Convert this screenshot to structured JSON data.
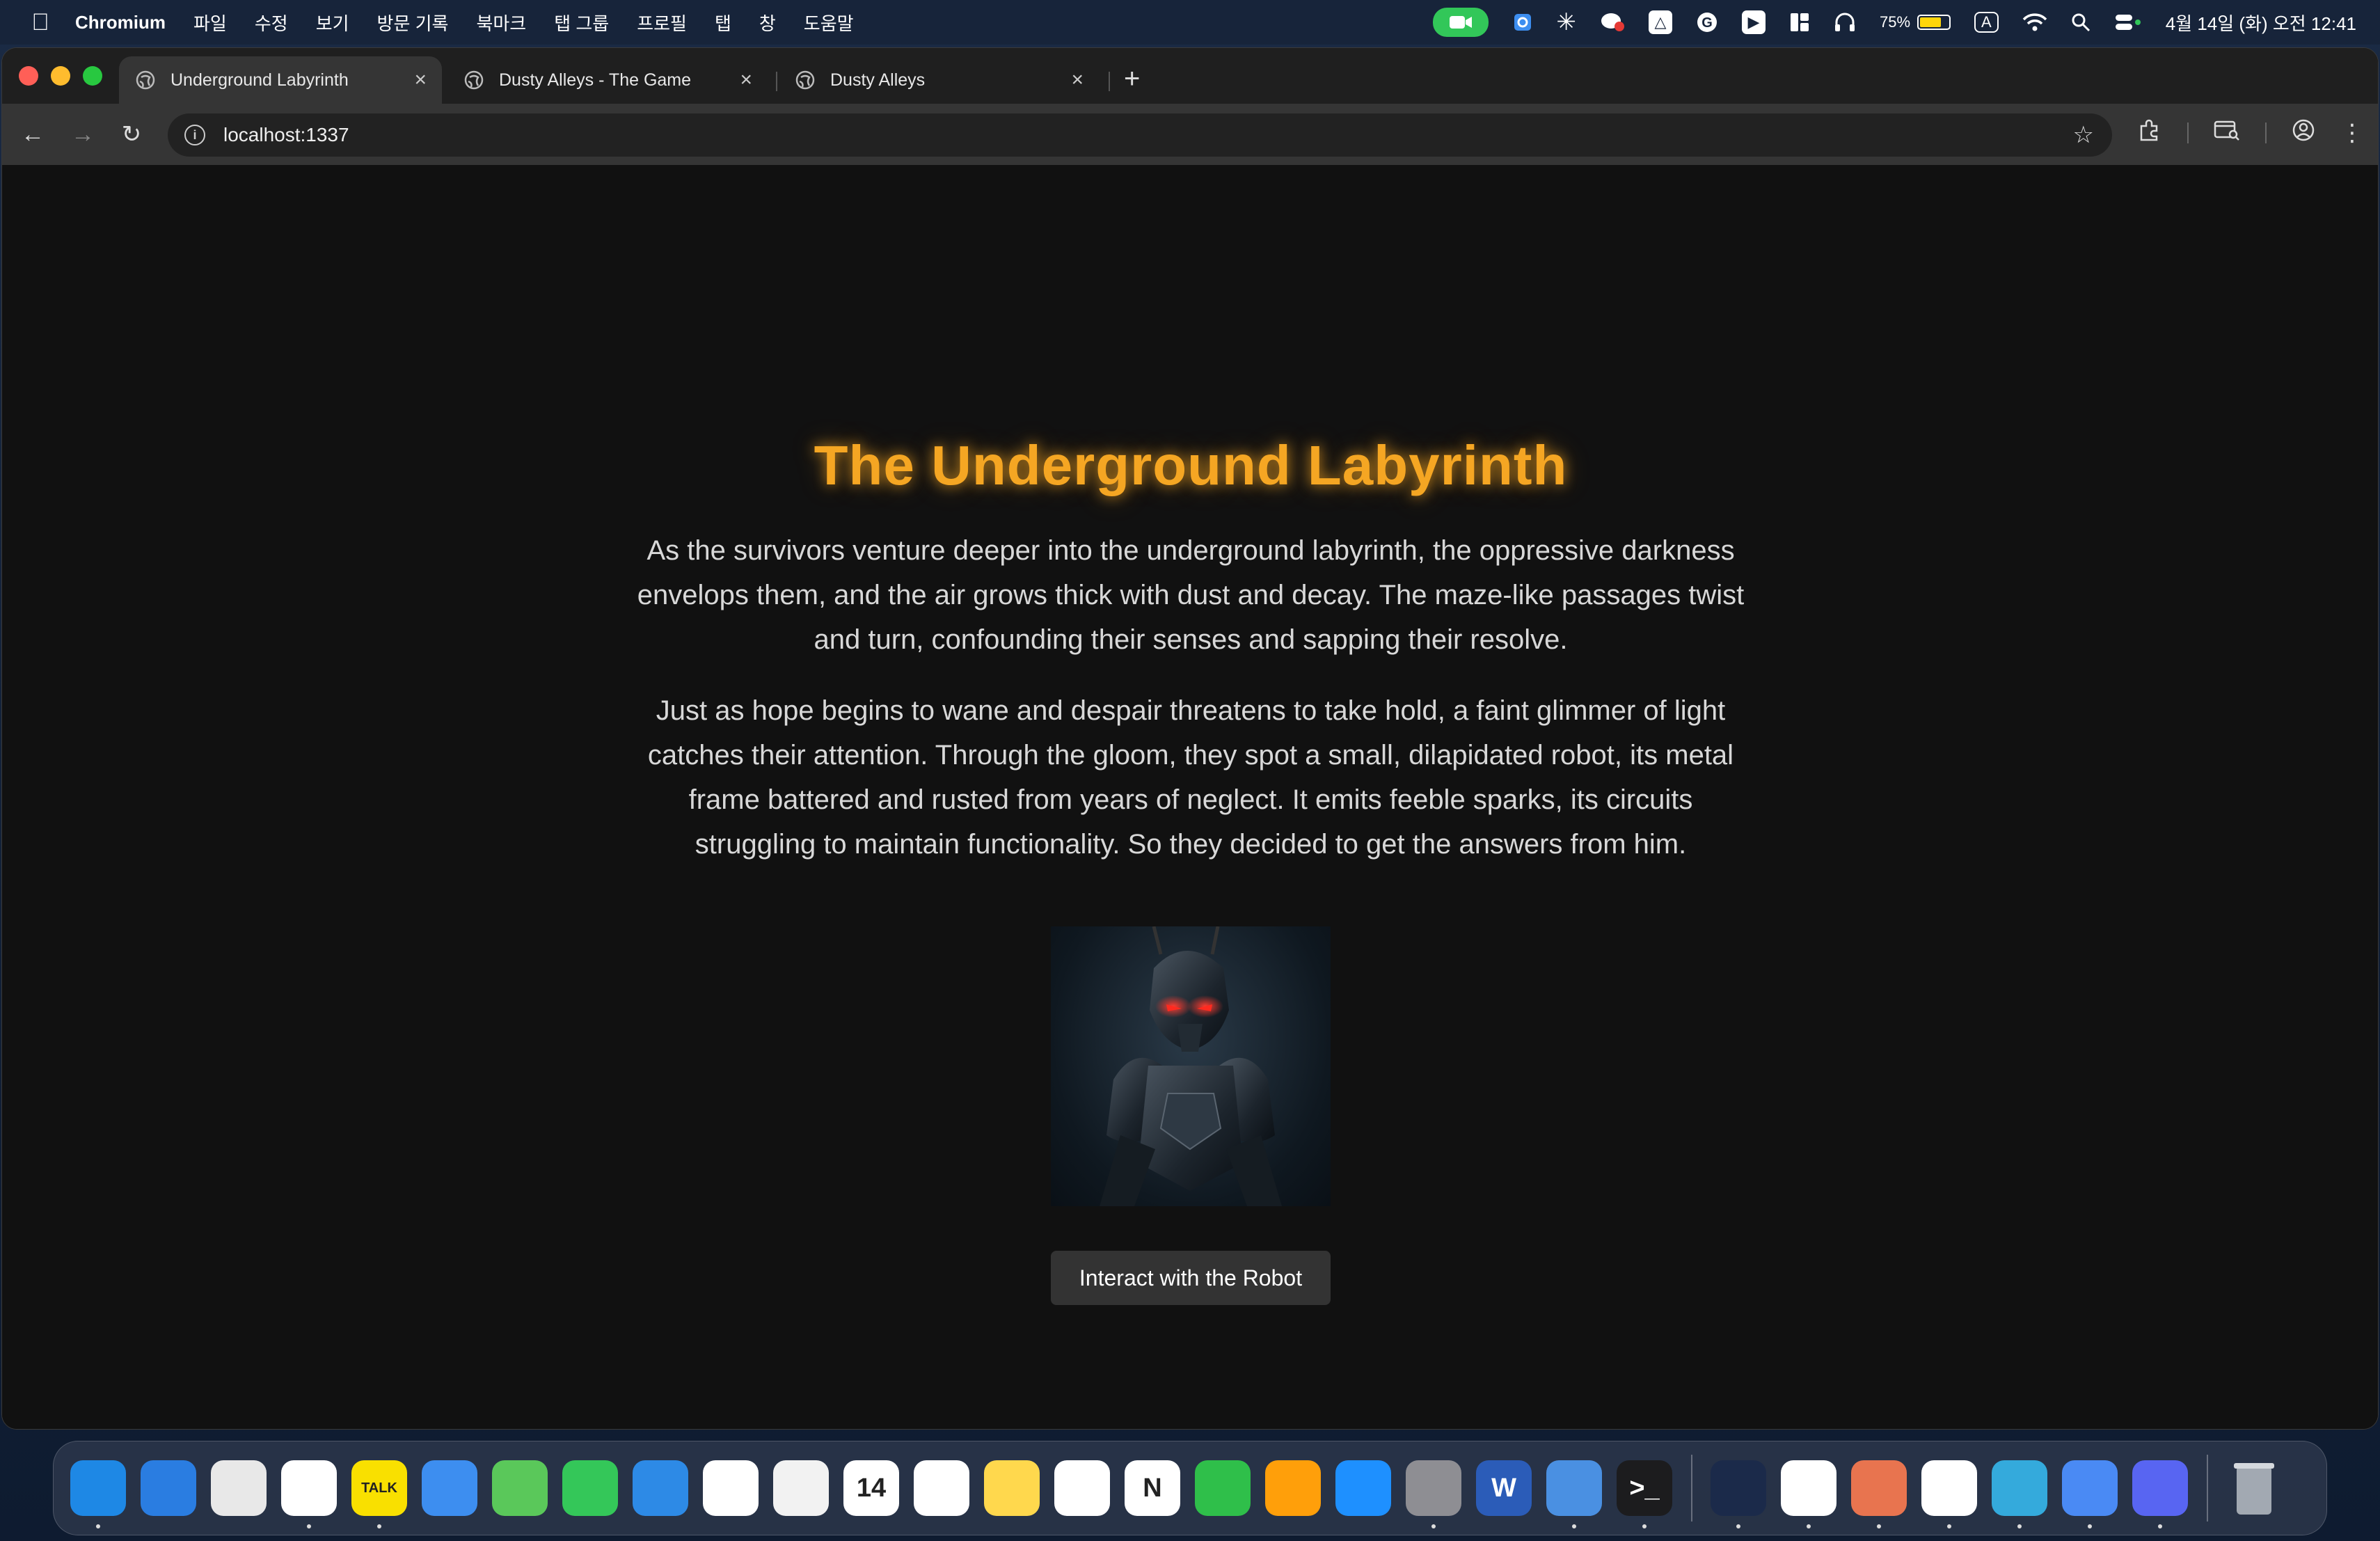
{
  "menubar": {
    "app_name": "Chromium",
    "menus": [
      "파일",
      "수정",
      "보기",
      "방문 기록",
      "북마크",
      "탭 그룹",
      "프로필",
      "탭",
      "창",
      "도움말"
    ],
    "battery_percent": "75%",
    "battery_level": 0.75,
    "input_indicator": "A",
    "clock": "4월 14일 (화) 오전 12:41"
  },
  "browser": {
    "tabs": [
      {
        "title": "Underground Labyrinth",
        "active": true
      },
      {
        "title": "Dusty Alleys - The Game",
        "active": false
      },
      {
        "title": "Dusty Alleys",
        "active": false
      }
    ],
    "new_tab_label": "+",
    "url": "localhost:1337"
  },
  "page": {
    "title": "The Underground Labyrinth",
    "paragraph1": "As the survivors venture deeper into the underground labyrinth, the oppressive darkness envelops them, and the air grows thick with dust and decay. The maze-like passages twist and turn, confounding their senses and sapping their resolve.",
    "paragraph2": "Just as hope begins to wane and despair threatens to take hold, a faint glimmer of light catches their attention. Through the gloom, they spot a small, dilapidated robot, its metal frame battered and rusted from years of neglect. It emits feeble sparks, its circuits struggling to maintain functionality. So they decided to get the answers from him.",
    "button_label": "Interact with the Robot",
    "title_color": "#f5a623"
  },
  "dock": {
    "apps": [
      {
        "name": "finder-icon",
        "label": "",
        "color": "#1e88e5"
      },
      {
        "name": "safari-icon",
        "label": "",
        "color": "#2a7de1"
      },
      {
        "name": "launchpad-icon",
        "label": "",
        "color": "#e8e8e8"
      },
      {
        "name": "chrome-icon",
        "label": "",
        "color": "#ffffff"
      },
      {
        "name": "kakaotalk-icon",
        "label": "TALK",
        "color": "#f9e000"
      },
      {
        "name": "mail-icon",
        "label": "",
        "color": "#3d8ef0"
      },
      {
        "name": "maps-icon",
        "label": "",
        "color": "#5ac85a"
      },
      {
        "name": "facetime-icon",
        "label": "",
        "color": "#34c759"
      },
      {
        "name": "keynote-icon",
        "label": "",
        "color": "#2d8ae6"
      },
      {
        "name": "photos-icon",
        "label": "",
        "color": "#ffffff"
      },
      {
        "name": "music-icon",
        "label": "",
        "color": "#f2f2f2"
      },
      {
        "name": "calendar-icon",
        "label": "14",
        "color": "#ffffff"
      },
      {
        "name": "reminders-icon",
        "label": "",
        "color": "#ffffff"
      },
      {
        "name": "notes-icon",
        "label": "",
        "color": "#ffd84d"
      },
      {
        "name": "freeform-icon",
        "label": "",
        "color": "#ffffff"
      },
      {
        "name": "notion-icon",
        "label": "N",
        "color": "#ffffff"
      },
      {
        "name": "numbers-icon",
        "label": "",
        "color": "#2fbf4a"
      },
      {
        "name": "pages-icon",
        "label": "",
        "color": "#ff9f0a"
      },
      {
        "name": "app-store-icon",
        "label": "",
        "color": "#1e90ff"
      },
      {
        "name": "system-settings-icon",
        "label": "",
        "color": "#8e8e93"
      },
      {
        "name": "word-icon",
        "label": "W",
        "color": "#2b5cb8"
      },
      {
        "name": "simulator-icon",
        "label": "",
        "color": "#4a90e2"
      },
      {
        "name": "terminal-icon",
        "label": ">_",
        "color": "#1c1c1e"
      },
      {
        "name": "arc-icon",
        "label": "",
        "color": "#1b2a4a"
      },
      {
        "name": "vscode-icon",
        "label": "",
        "color": "#ffffff"
      },
      {
        "name": "claude-icon",
        "label": "",
        "color": "#e8744f"
      },
      {
        "name": "xcode-store-icon",
        "label": "",
        "color": "#ffffff"
      },
      {
        "name": "reeder-icon",
        "label": "",
        "color": "#34aadc"
      },
      {
        "name": "chromium-icon",
        "label": "",
        "color": "#4a8af4"
      },
      {
        "name": "discord-icon",
        "label": "",
        "color": "#5865f2"
      },
      {
        "name": "trash-icon",
        "label": "",
        "color": "#9aa0a6"
      }
    ]
  }
}
